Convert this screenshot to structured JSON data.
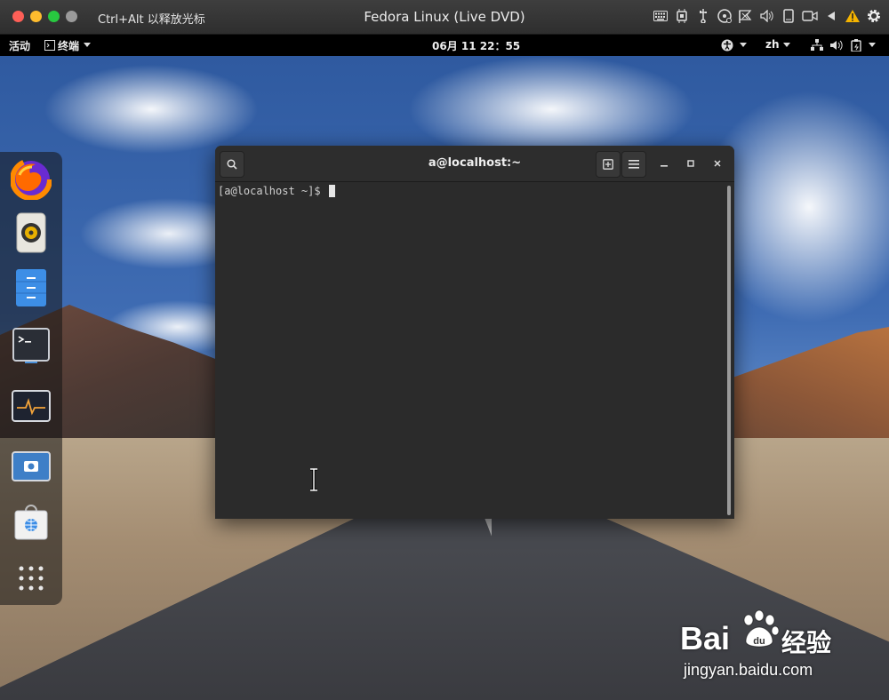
{
  "host": {
    "hint": "Ctrl+Alt 以释放光标",
    "window_title": "Fedora Linux (Live DVD)",
    "traffic_lights": [
      "#fe5f57",
      "#febc2e",
      "#28c840",
      "#9a9a9a"
    ],
    "icons": [
      "keyboard-icon",
      "cpu-icon",
      "usb-icon",
      "disc-icon",
      "network-icon",
      "sound-icon",
      "device-icon",
      "camera-icon",
      "back-icon",
      "warning-icon",
      "gear-icon"
    ]
  },
  "top_bar": {
    "activities": "活动",
    "app_menu": "终端",
    "clock": "06月 11  22：55",
    "lang": "zh",
    "icons": [
      "accessibility-icon",
      "chevron-down-icon",
      "language-icon",
      "network-icon",
      "volume-icon",
      "power-icon"
    ]
  },
  "dock": {
    "items": [
      "firefox-icon",
      "rhythmbox-icon",
      "files-icon",
      "terminal-icon",
      "system-monitor-icon",
      "screenshot-icon",
      "software-icon",
      "show-apps-icon"
    ]
  },
  "terminal": {
    "title": "a@localhost:~",
    "prompt": "[a@localhost ~]$ ",
    "buttons": [
      "search-icon",
      "new-tab-icon",
      "menu-icon",
      "minimize-icon",
      "maximize-icon",
      "close-icon"
    ]
  },
  "watermark": {
    "brand": "Bai",
    "suffix": "经验",
    "url": "jingyan.baidu.com"
  },
  "colors": {
    "terminal_bg": "#2b2b2b",
    "topbar_bg": "#000000",
    "host_bar_bg": "#333333"
  }
}
